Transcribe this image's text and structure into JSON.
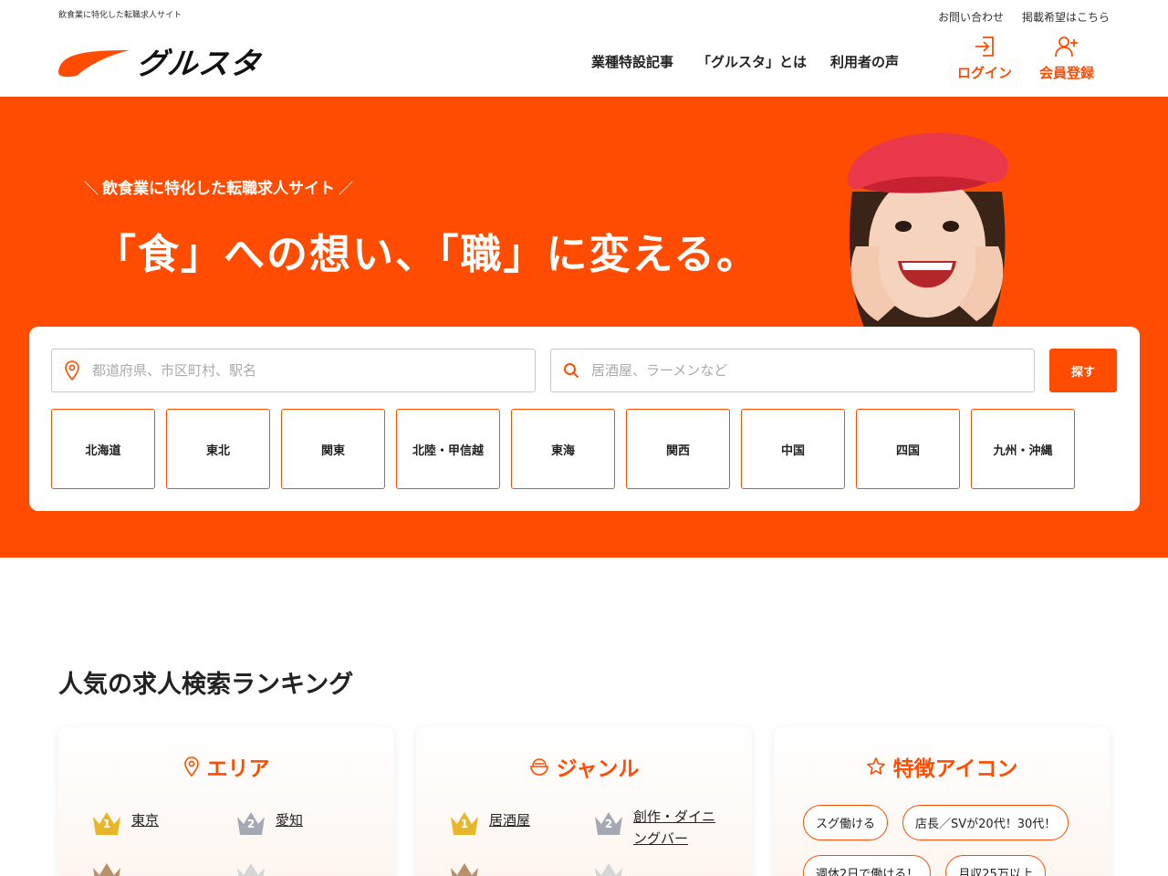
{
  "header": {
    "tagline": "飲食業に特化した転職求人サイト",
    "top_links": [
      "お問い合わせ",
      "掲載希望はこちら"
    ],
    "logo_text": "グルスタ",
    "nav": [
      "業種特設記事",
      "「グルスタ」とは",
      "利用者の声"
    ],
    "login_label": "ログイン",
    "register_label": "会員登録",
    "brand_color": "#ff4c00"
  },
  "hero": {
    "subtitle": "飲食業に特化した転職求人サイト",
    "title": "「食」への想い、「職」に変える。",
    "background_color": "#ff4c00"
  },
  "search": {
    "area_placeholder": "都道府県、市区町村、駅名",
    "keyword_placeholder": "居酒屋、ラーメンなど",
    "button_label": "探す",
    "regions": [
      "北海道",
      "東北",
      "関東",
      "北陸・甲信越",
      "東海",
      "関西",
      "中国",
      "四国",
      "九州・沖縄"
    ]
  },
  "ranking": {
    "title": "人気の求人検索ランキング",
    "area": {
      "heading": "エリア",
      "items": [
        {
          "rank": "1",
          "label": "東京"
        },
        {
          "rank": "2",
          "label": "愛知"
        }
      ]
    },
    "genre": {
      "heading": "ジャンル",
      "items": [
        {
          "rank": "1",
          "label": "居酒屋"
        },
        {
          "rank": "2",
          "label": "創作・ダイニングバー"
        }
      ]
    },
    "features": {
      "heading": "特徴アイコン",
      "tags": [
        "スグ働ける",
        "店長／SVが20代！30代！",
        "週休2日で働ける！",
        "月収25万以上"
      ]
    }
  },
  "crown_colors": {
    "gold": "#e8b62a",
    "silver": "#a4a9b4",
    "bronze": "#b8906b"
  }
}
